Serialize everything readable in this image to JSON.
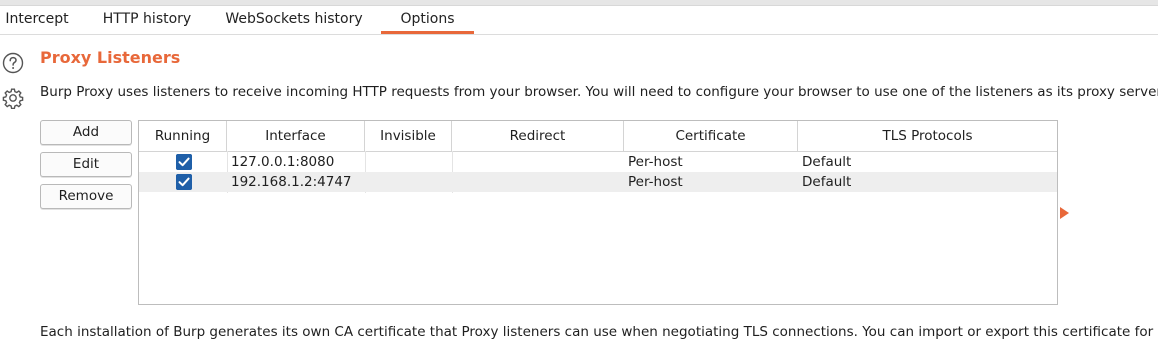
{
  "tabs": [
    {
      "label": "Intercept"
    },
    {
      "label": "HTTP history"
    },
    {
      "label": "WebSockets history"
    },
    {
      "label": "Options"
    }
  ],
  "active_tab": "Options",
  "section": {
    "title": "Proxy Listeners",
    "description": "Burp Proxy uses listeners to receive incoming HTTP requests from your browser. You will need to configure your browser to use one of the listeners as its proxy server."
  },
  "buttons": {
    "add": "Add",
    "edit": "Edit",
    "remove": "Remove"
  },
  "table": {
    "columns": [
      "Running",
      "Interface",
      "Invisible",
      "Redirect",
      "Certificate",
      "TLS Protocols"
    ],
    "rows": [
      {
        "running": true,
        "interface": "127.0.0.1:8080",
        "invisible": "",
        "redirect": "",
        "certificate": "Per-host",
        "tls": "Default"
      },
      {
        "running": true,
        "interface": "192.168.1.2:4747",
        "invisible": "",
        "redirect": "",
        "certificate": "Per-host",
        "tls": "Default"
      }
    ]
  },
  "footer_text": "Each installation of Burp generates its own CA certificate that Proxy listeners can use when negotiating TLS connections. You can import or export this certificate for us",
  "colors": {
    "accent": "#e8683a",
    "checkbox": "#1f5fa8"
  },
  "icons": [
    "help-icon",
    "settings-gear-icon",
    "expand-arrow-icon",
    "checkmark-icon"
  ]
}
